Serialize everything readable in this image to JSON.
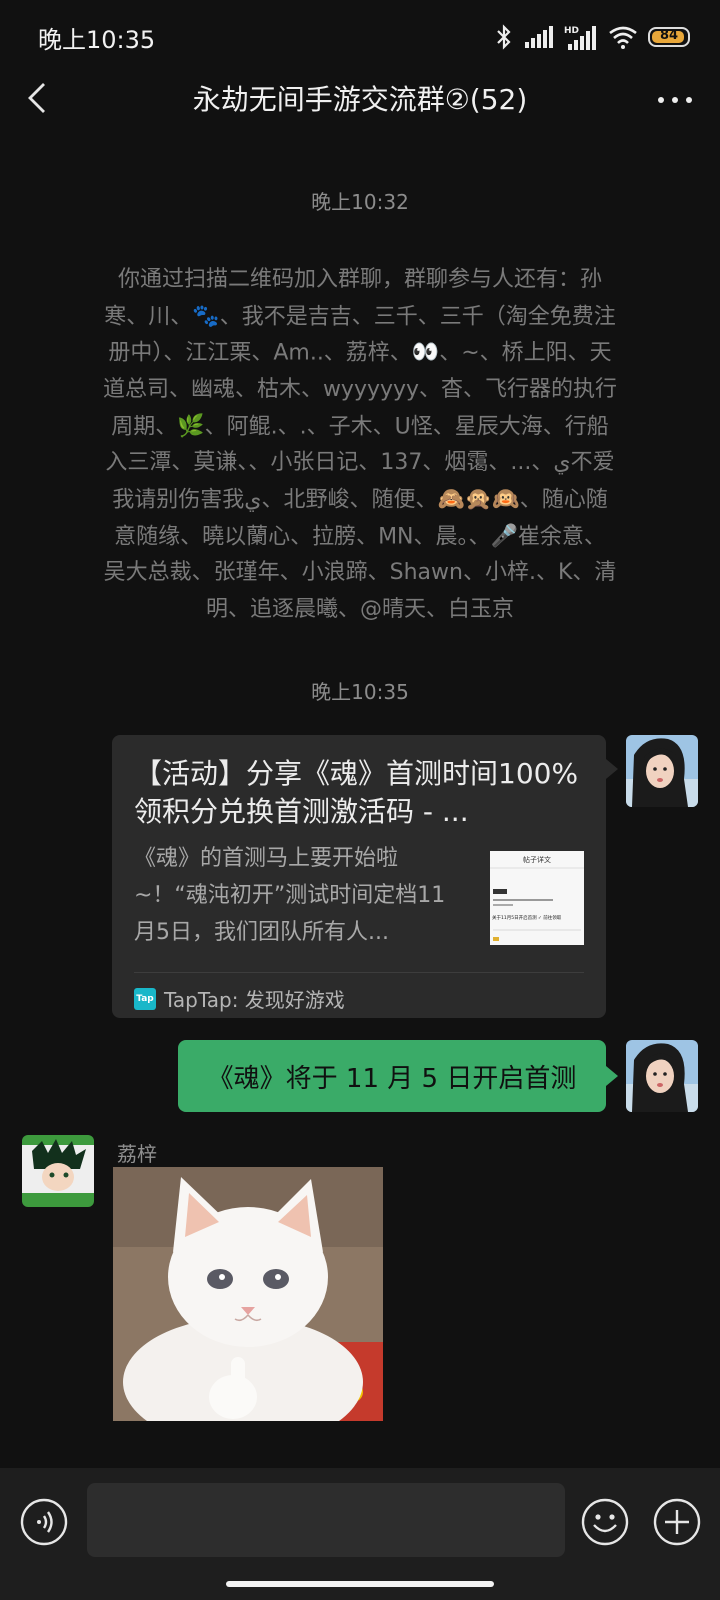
{
  "status_bar": {
    "time": "晚上10:35",
    "battery": "84",
    "network_badge": "HD",
    "icons": [
      "bluetooth-icon",
      "signal-icon",
      "hd-signal-icon",
      "wifi-icon",
      "battery-icon"
    ]
  },
  "header": {
    "title": "永劫无间手游交流群②(52)",
    "back_icon": "chevron-left-icon",
    "more_icon": "more-dots-icon"
  },
  "messages": {
    "time_1": "晚上10:32",
    "system_join": {
      "lines": [
        {
          "segments": [
            {
              "text": "你通过扫描二维码加入群聊，群聊参与人还有：孙"
            }
          ]
        },
        {
          "segments": [
            {
              "text": "寒、川、"
            },
            {
              "emoji": "🐾"
            },
            {
              "text": "、我不是吉吉、三千、三千（淘全免费注"
            }
          ]
        },
        {
          "segments": [
            {
              "text": "册中）、江江栗、Am..、荔梓、"
            },
            {
              "emoji": "👀"
            },
            {
              "text": "、~、桥上阳、天"
            }
          ]
        },
        {
          "segments": [
            {
              "text": "道总司、幽魂、枯木、wyyyyyy、杳、飞行器的执行"
            }
          ]
        },
        {
          "segments": [
            {
              "text": "周期、"
            },
            {
              "emoji": "🌿"
            },
            {
              "text": "、阿鲲.、.、子木、U怪、星辰大海、行船"
            }
          ]
        },
        {
          "segments": [
            {
              "text": "入三潭、莫谦、、小张日记、137、烟霭、...、ي不爱"
            }
          ]
        },
        {
          "segments": [
            {
              "text": "我请别伤害我ي、北野峻、随便、"
            },
            {
              "emoji": "🙈🙊🙉"
            },
            {
              "text": "、随心随"
            }
          ]
        },
        {
          "segments": [
            {
              "text": "意随缘、曉以蘭心、拉膀、MN、晨。、"
            },
            {
              "emoji": "🎤"
            },
            {
              "text": "崔余意、"
            }
          ]
        },
        {
          "segments": [
            {
              "text": "吴大总裁、张瑾年、小浪蹄、Shawn、小梓.、K、清"
            }
          ]
        },
        {
          "segments": [
            {
              "text": "明、追逐晨曦、@晴天、白玉京"
            }
          ]
        }
      ]
    },
    "time_2": "晚上10:35",
    "link_card": {
      "title": "【活动】分享《魂》首测时间100%领积分兑换首测激活码 - ...",
      "description": "《魂》的首测马上要开始啦~！“魂沌初开”测试时间定档11月5日，我们团队所有人...",
      "source": "TapTap: 发现好游戏",
      "source_badge": "Tap",
      "thumb_heading": "帖子详文",
      "thumb_caption": "关于11月5日开启首测 ✓ 前往领取"
    },
    "sent_text": "《魂》将于 11 月 5 日开启首测",
    "received": {
      "sender": "荔梓",
      "sticker_icon": "white-cat-thumbs-up-sticker"
    }
  },
  "input_bar": {
    "voice_icon": "voice-icon",
    "emoji_icon": "smiley-icon",
    "plus_icon": "plus-circle-icon"
  },
  "colors": {
    "background": "#111111",
    "sent_bubble": "#3aab68",
    "card_background": "#2b2b2b",
    "battery": "#e8a73a"
  }
}
